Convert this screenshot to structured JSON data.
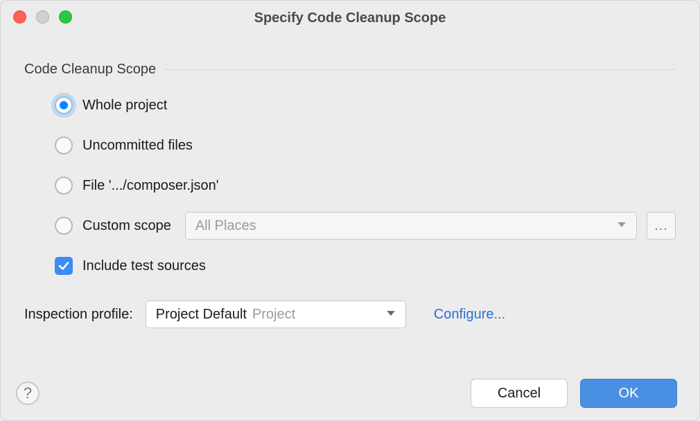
{
  "window": {
    "title": "Specify Code Cleanup Scope"
  },
  "section": {
    "title": "Code Cleanup Scope"
  },
  "scope": {
    "whole_project": "Whole project",
    "uncommitted_files": "Uncommitted files",
    "file": "File '.../composer.json'",
    "custom_scope": "Custom scope",
    "custom_scope_value": "All Places",
    "ellipsis": "...",
    "include_test_sources": "Include test sources",
    "selected": "whole_project",
    "include_test_checked": true
  },
  "profile": {
    "label": "Inspection profile:",
    "value": "Project Default",
    "sub": "Project",
    "configure": "Configure..."
  },
  "buttons": {
    "cancel": "Cancel",
    "ok": "OK",
    "help": "?"
  }
}
